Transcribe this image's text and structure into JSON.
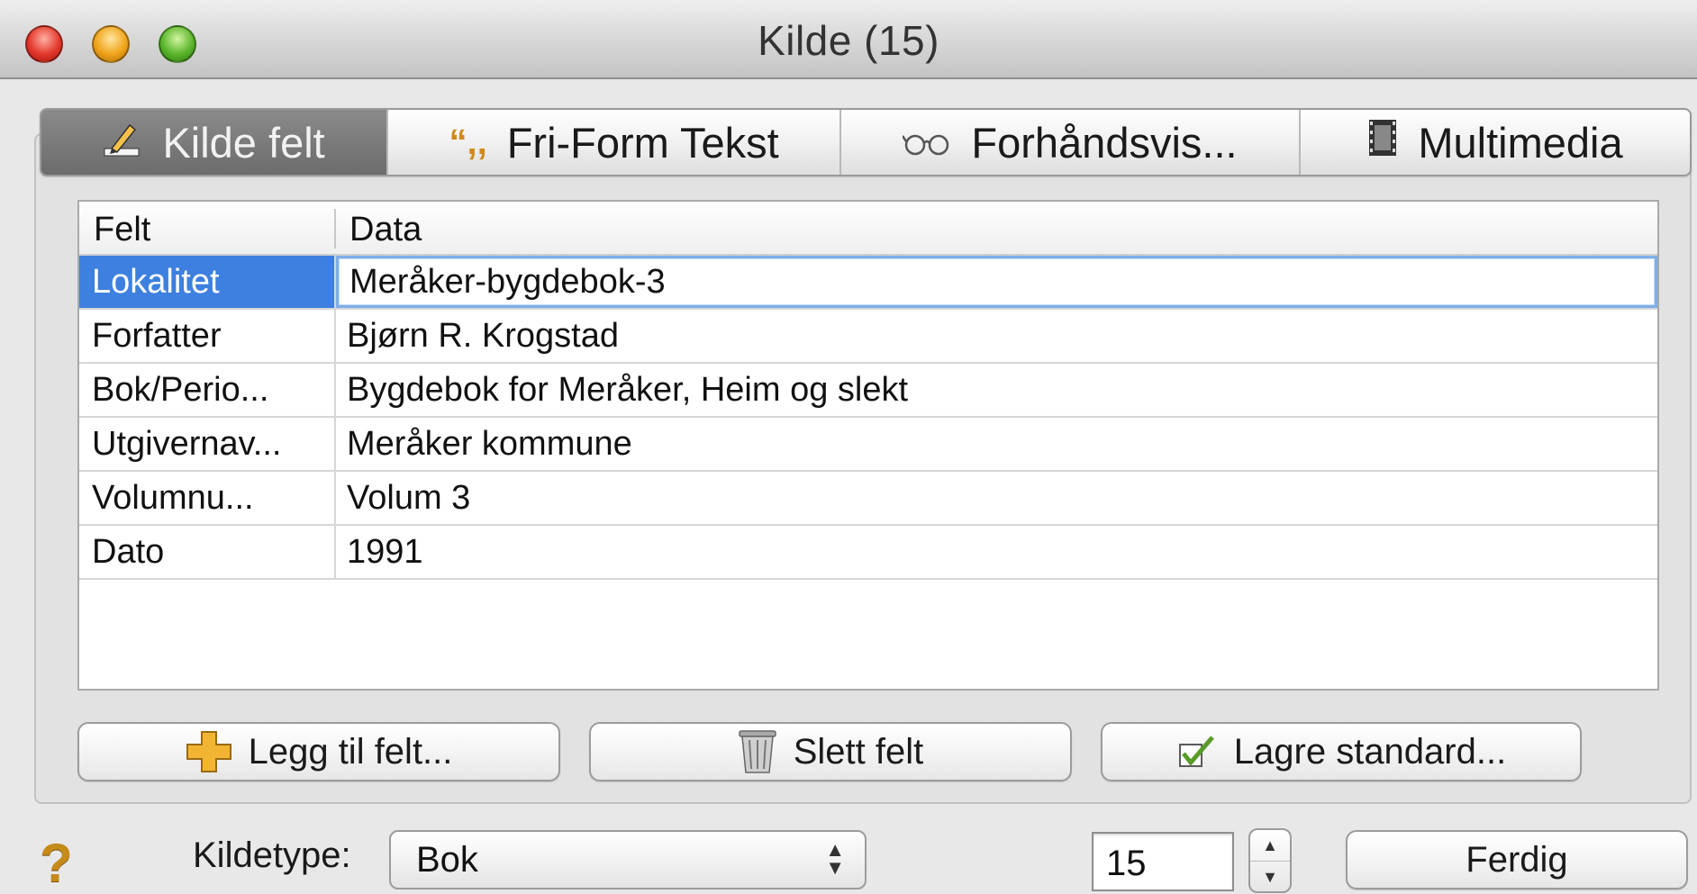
{
  "window": {
    "title": "Kilde (15)"
  },
  "tabs": [
    {
      "label": "Kilde felt",
      "icon": "pencil-icon",
      "active": true
    },
    {
      "label": "Fri-Form Tekst",
      "icon": "quote-icon",
      "active": false
    },
    {
      "label": "Forhåndsvis...",
      "icon": "glasses-icon",
      "active": false
    },
    {
      "label": "Multimedia",
      "icon": "film-icon",
      "active": false
    }
  ],
  "table": {
    "headers": {
      "felt": "Felt",
      "data": "Data"
    },
    "rows": [
      {
        "felt": "Lokalitet",
        "data": "Meråker-bygdebok-3"
      },
      {
        "felt": "Forfatter",
        "data": "Bjørn R. Krogstad"
      },
      {
        "felt": "Bok/Perio...",
        "data": "Bygdebok for Meråker, Heim og slekt"
      },
      {
        "felt": "Utgivernav...",
        "data": "Meråker kommune"
      },
      {
        "felt": "Volumnu...",
        "data": "Volum 3"
      },
      {
        "felt": "Dato",
        "data": "1991"
      }
    ],
    "selected_row": 0
  },
  "buttons": {
    "add": "Legg til felt...",
    "delete": "Slett felt",
    "save_default": "Lagre standard..."
  },
  "footer": {
    "help": "?",
    "kildetype_label": "Kildetype:",
    "kildetype_value": "Bok",
    "number_value": "15",
    "done": "Ferdig"
  },
  "colors": {
    "selection": "#3d80df",
    "active_tab": "#7a7a7a",
    "help": "#c48a1a"
  }
}
